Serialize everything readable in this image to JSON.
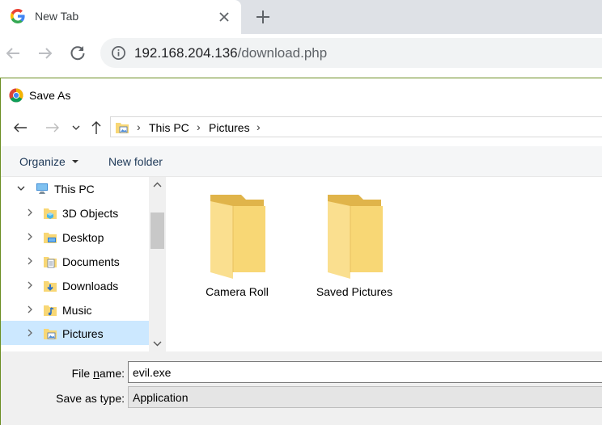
{
  "browser": {
    "tab": {
      "title": "New Tab"
    },
    "omnibox": {
      "host": "192.168.204.136",
      "path": "/download.php"
    }
  },
  "dialog": {
    "title": "Save As",
    "breadcrumb": [
      "This PC",
      "Pictures"
    ],
    "commands": {
      "organize": "Organize",
      "new_folder": "New folder"
    },
    "nav_tree": [
      {
        "label": "This PC",
        "icon": "pc-icon",
        "expanded": true
      },
      {
        "label": "3D Objects",
        "icon": "3d-objects-icon"
      },
      {
        "label": "Desktop",
        "icon": "desktop-folder-icon"
      },
      {
        "label": "Documents",
        "icon": "documents-folder-icon"
      },
      {
        "label": "Downloads",
        "icon": "downloads-folder-icon"
      },
      {
        "label": "Music",
        "icon": "music-folder-icon"
      },
      {
        "label": "Pictures",
        "icon": "pictures-folder-icon",
        "selected": true
      }
    ],
    "folders": [
      {
        "label": "Camera Roll"
      },
      {
        "label": "Saved Pictures"
      }
    ],
    "file_name": {
      "label_pre": "File ",
      "label_key": "n",
      "label_post": "ame:",
      "value": "evil.exe"
    },
    "save_type": {
      "label": "Save as type:",
      "value": "Application"
    }
  },
  "colors": {
    "folder": "#f8d775",
    "selection": "#cce8ff",
    "accent": "#1e3958"
  }
}
